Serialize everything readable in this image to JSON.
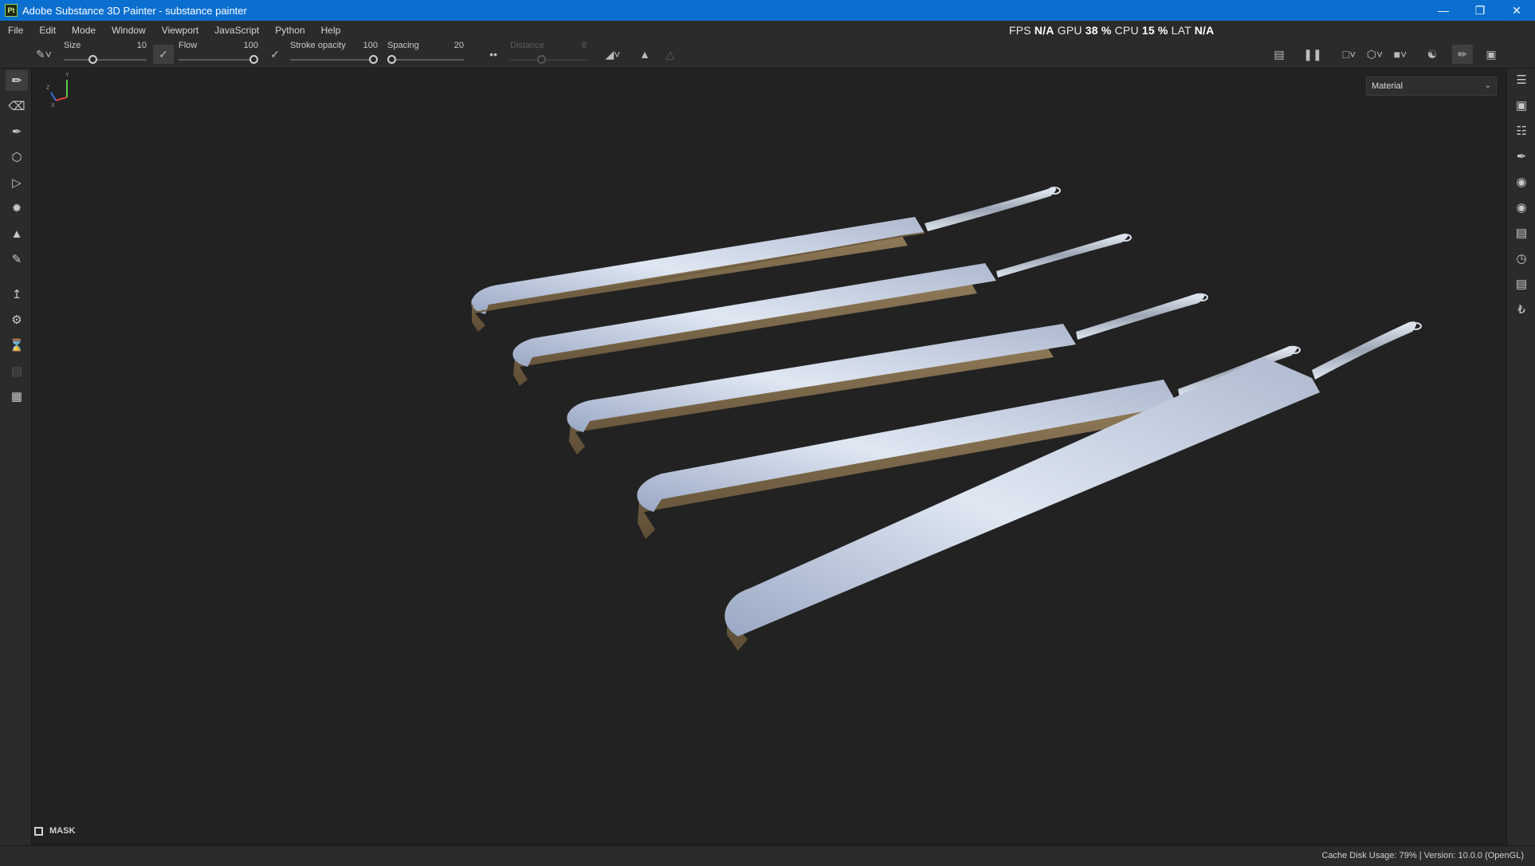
{
  "window": {
    "title": "Adobe Substance 3D Painter - substance painter",
    "logo_text": "Pt",
    "minimize_icon": "minimize-icon",
    "restore_icon": "restore-icon",
    "close_icon": "close-icon"
  },
  "menu": [
    "File",
    "Edit",
    "Mode",
    "Window",
    "Viewport",
    "JavaScript",
    "Python",
    "Help"
  ],
  "perf": {
    "fps_label": "FPS",
    "fps_value": "N/A",
    "gpu_label": "GPU",
    "gpu_value": "38 %",
    "cpu_label": "CPU",
    "cpu_value": "15 %",
    "lat_label": "LAT",
    "lat_value": "N/A"
  },
  "toolbar": {
    "size": {
      "label": "Size",
      "value": "10",
      "fraction": 0.33
    },
    "flow": {
      "label": "Flow",
      "value": "100",
      "fraction": 1.0
    },
    "stroke_opacity": {
      "label": "Stroke opacity",
      "value": "100",
      "fraction": 1.0
    },
    "spacing": {
      "label": "Spacing",
      "value": "20",
      "fraction": 0.0
    },
    "distance": {
      "label": "Distance",
      "value": "8",
      "fraction": 0.4,
      "disabled": true
    }
  },
  "viewport": {
    "material_dropdown": "Material",
    "mask_label": "MASK",
    "axis_labels": {
      "x": "X",
      "y": "Y",
      "z": "Z"
    }
  },
  "status": {
    "text": "Cache Disk Usage:   79% | Version: 10.0.0 (OpenGL)"
  },
  "colors": {
    "titlebar": "#0b6fd0",
    "panel": "#2b2b2b",
    "viewport": "#222222",
    "blade_top": "#c9d6e6",
    "blade_edge": "#8a7352"
  }
}
